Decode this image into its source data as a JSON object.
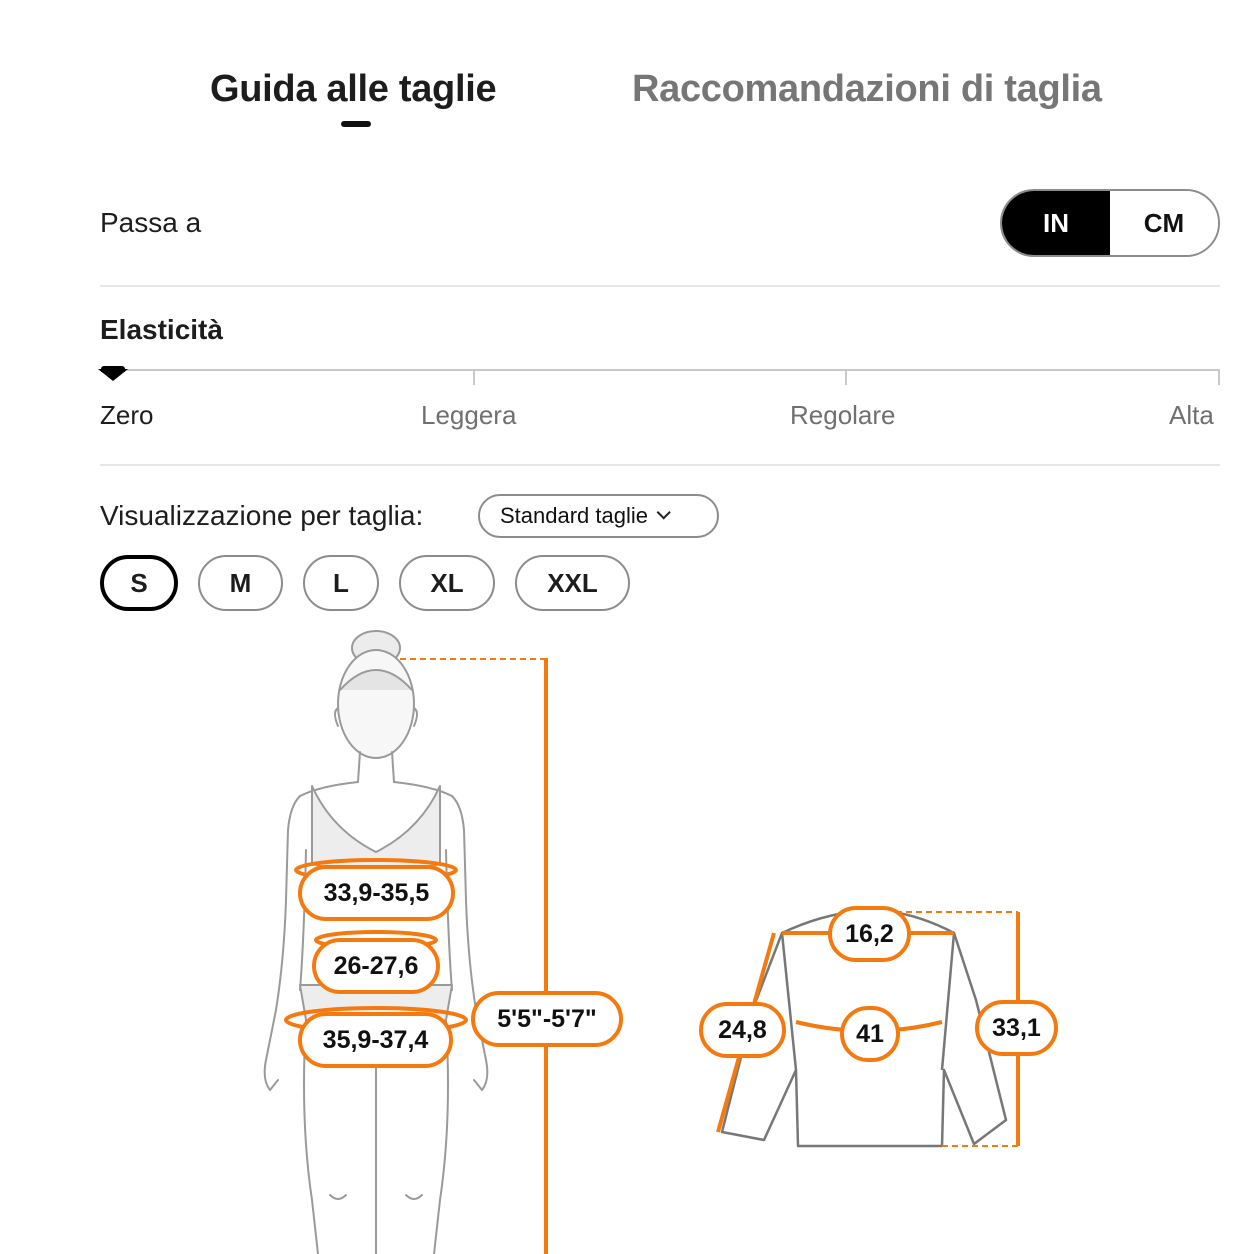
{
  "tabs": [
    {
      "label": "Guida alle taglie",
      "active": true
    },
    {
      "label": "Raccomandazioni di taglia",
      "active": false
    }
  ],
  "unit_switch": {
    "label": "Passa a",
    "options": [
      "IN",
      "CM"
    ],
    "selected": "IN"
  },
  "elasticity": {
    "title": "Elasticità",
    "stops": [
      "Zero",
      "Leggera",
      "Regolare",
      "Alta"
    ],
    "selected": "Zero"
  },
  "size_view": {
    "label": "Visualizzazione per taglia:",
    "dropdown_value": "Standard taglie",
    "dropdown_icon": "chevron-down-icon"
  },
  "sizes": [
    "S",
    "M",
    "L",
    "XL",
    "XXL"
  ],
  "selected_size": "S",
  "body_measurements": {
    "bust": "33,9-35,5",
    "waist": "26-27,6",
    "hips": "35,9-37,4",
    "height": "5'5\"-5'7\""
  },
  "garment_measurements": {
    "shoulder": "16,2",
    "sleeve": "24,8",
    "chest": "41",
    "length": "33,1"
  },
  "colors": {
    "accent": "#f47a10",
    "selected": "#000000",
    "muted_text": "#767676"
  }
}
